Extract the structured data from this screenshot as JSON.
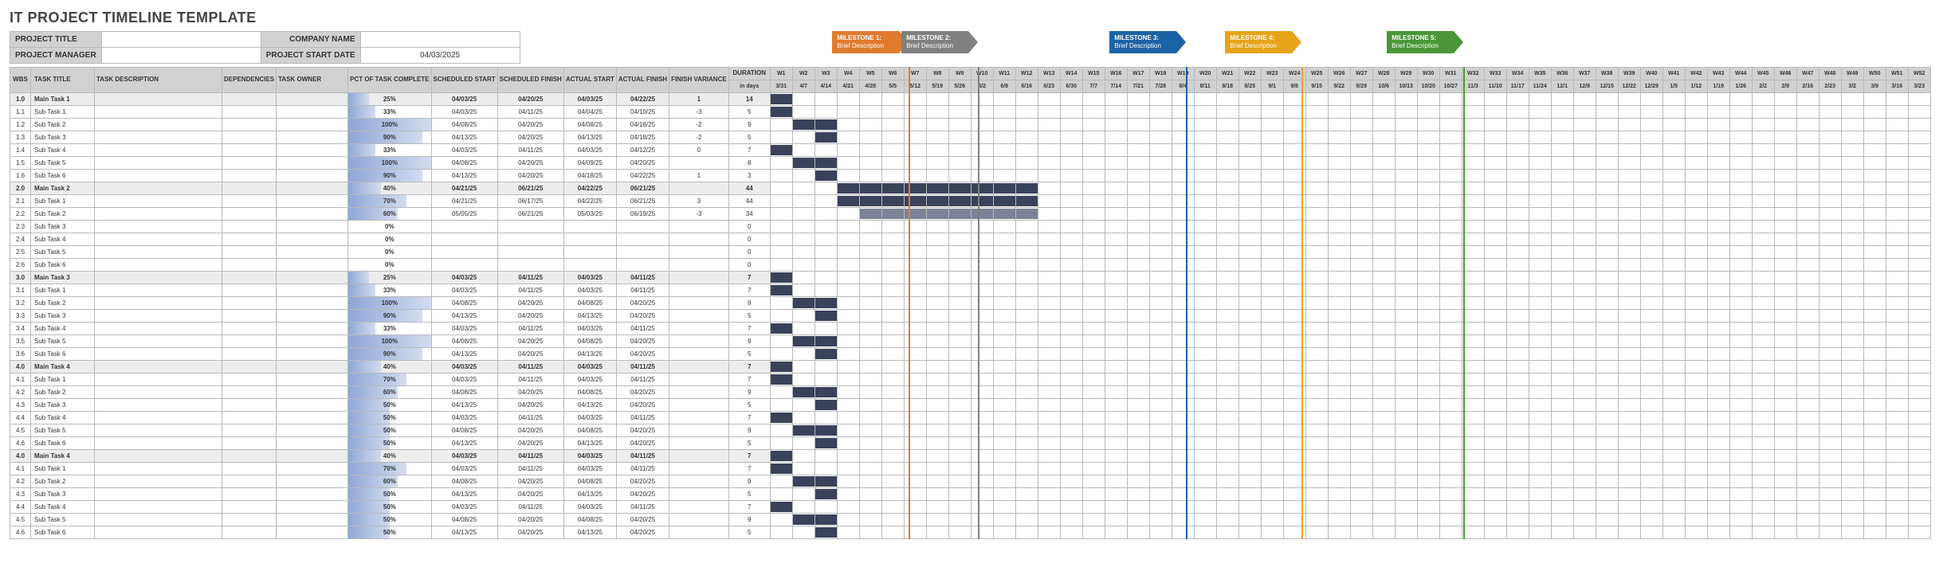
{
  "title": "IT PROJECT TIMELINE TEMPLATE",
  "info": {
    "project_title_lbl": "PROJECT TITLE",
    "project_title": "",
    "company_lbl": "COMPANY NAME",
    "company": "",
    "pm_lbl": "PROJECT MANAGER",
    "pm": "",
    "start_lbl": "PROJECT START DATE",
    "start": "04/03/2025"
  },
  "headers": {
    "wbs": "WBS",
    "task_title": "TASK TITLE",
    "task_desc": "TASK DESCRIPTION",
    "dep": "DEPENDENCIES",
    "owner": "TASK OWNER",
    "pct": "PCT OF TASK COMPLETE",
    "ss": "SCHEDULED START",
    "sf": "SCHEDULED FINISH",
    "as": "ACTUAL START",
    "af": "ACTUAL FINISH",
    "fv": "FINISH VARIANCE",
    "dur": "DURATION",
    "dur2": "in days"
  },
  "weeks": [
    {
      "w": "W1",
      "d": "3/31"
    },
    {
      "w": "W2",
      "d": "4/7"
    },
    {
      "w": "W3",
      "d": "4/14"
    },
    {
      "w": "W4",
      "d": "4/21"
    },
    {
      "w": "W5",
      "d": "4/28"
    },
    {
      "w": "W6",
      "d": "5/5"
    },
    {
      "w": "W7",
      "d": "5/12"
    },
    {
      "w": "W8",
      "d": "5/19"
    },
    {
      "w": "W9",
      "d": "5/26"
    },
    {
      "w": "W10",
      "d": "6/2"
    },
    {
      "w": "W11",
      "d": "6/9"
    },
    {
      "w": "W12",
      "d": "6/16"
    },
    {
      "w": "W13",
      "d": "6/23"
    },
    {
      "w": "W14",
      "d": "6/30"
    },
    {
      "w": "W15",
      "d": "7/7"
    },
    {
      "w": "W16",
      "d": "7/14"
    },
    {
      "w": "W17",
      "d": "7/21"
    },
    {
      "w": "W18",
      "d": "7/28"
    },
    {
      "w": "W19",
      "d": "8/4"
    },
    {
      "w": "W20",
      "d": "8/11"
    },
    {
      "w": "W21",
      "d": "8/18"
    },
    {
      "w": "W22",
      "d": "8/25"
    },
    {
      "w": "W23",
      "d": "9/1"
    },
    {
      "w": "W24",
      "d": "9/8"
    },
    {
      "w": "W25",
      "d": "9/15"
    },
    {
      "w": "W26",
      "d": "9/22"
    },
    {
      "w": "W27",
      "d": "9/29"
    },
    {
      "w": "W28",
      "d": "10/6"
    },
    {
      "w": "W29",
      "d": "10/13"
    },
    {
      "w": "W30",
      "d": "10/20"
    },
    {
      "w": "W31",
      "d": "10/27"
    },
    {
      "w": "W32",
      "d": "11/3"
    },
    {
      "w": "W33",
      "d": "11/10"
    },
    {
      "w": "W34",
      "d": "11/17"
    },
    {
      "w": "W35",
      "d": "11/24"
    },
    {
      "w": "W36",
      "d": "12/1"
    },
    {
      "w": "W37",
      "d": "12/8"
    },
    {
      "w": "W38",
      "d": "12/15"
    },
    {
      "w": "W39",
      "d": "12/22"
    },
    {
      "w": "W40",
      "d": "12/29"
    },
    {
      "w": "W41",
      "d": "1/5"
    },
    {
      "w": "W42",
      "d": "1/12"
    },
    {
      "w": "W43",
      "d": "1/19"
    },
    {
      "w": "W44",
      "d": "1/26"
    },
    {
      "w": "W45",
      "d": "2/2"
    },
    {
      "w": "W46",
      "d": "2/9"
    },
    {
      "w": "W47",
      "d": "2/16"
    },
    {
      "w": "W48",
      "d": "2/23"
    },
    {
      "w": "W49",
      "d": "3/2"
    },
    {
      "w": "W50",
      "d": "3/9"
    },
    {
      "w": "W51",
      "d": "3/16"
    },
    {
      "w": "W52",
      "d": "3/23"
    }
  ],
  "milestones": [
    {
      "name": "MILESTONE 1:",
      "sub": "Brief Description",
      "color": "#e07b2e",
      "week": 7
    },
    {
      "name": "MILESTONE 2:",
      "sub": "Brief Description",
      "color": "#808080",
      "week": 10
    },
    {
      "name": "MILESTONE 3:",
      "sub": "Brief Description",
      "color": "#1b62a5",
      "week": 19
    },
    {
      "name": "MILESTONE 4:",
      "sub": "Brief Description",
      "color": "#e8a41a",
      "week": 24
    },
    {
      "name": "MILESTONE 5:",
      "sub": "Brief Description",
      "color": "#4a9638",
      "week": 31
    }
  ],
  "rows": [
    {
      "main": true,
      "wbs": "1.0",
      "title": "Main Task 1",
      "pct": "25%",
      "ss": "04/03/25",
      "sf": "04/20/25",
      "as": "04/03/25",
      "af": "04/22/25",
      "fv": "1",
      "dur": "14",
      "bars": [
        [
          0,
          1
        ]
      ]
    },
    {
      "wbs": "1.1",
      "title": "Sub Task 1",
      "pct": "33%",
      "ss": "04/03/25",
      "sf": "04/11/25",
      "as": "04/04/25",
      "af": "04/10/25",
      "fv": "-3",
      "dur": "5",
      "bars": [
        [
          0,
          1
        ]
      ]
    },
    {
      "wbs": "1.2",
      "title": "Sub Task 2",
      "pct": "100%",
      "ss": "04/08/25",
      "sf": "04/20/25",
      "as": "04/08/25",
      "af": "04/18/25",
      "fv": "-2",
      "dur": "9",
      "bars": [
        [
          1,
          2
        ]
      ]
    },
    {
      "wbs": "1.3",
      "title": "Sub Task 3",
      "pct": "90%",
      "ss": "04/13/25",
      "sf": "04/20/25",
      "as": "04/13/25",
      "af": "04/18/25",
      "fv": "-2",
      "dur": "5",
      "bars": [
        [
          2,
          1
        ]
      ]
    },
    {
      "wbs": "1.4",
      "title": "Sub Task 4",
      "pct": "33%",
      "ss": "04/03/25",
      "sf": "04/11/25",
      "as": "04/03/25",
      "af": "04/12/25",
      "fv": "0",
      "dur": "7",
      "bars": [
        [
          0,
          1
        ]
      ]
    },
    {
      "wbs": "1.5",
      "title": "Sub Task 5",
      "pct": "100%",
      "ss": "04/08/25",
      "sf": "04/20/25",
      "as": "04/09/25",
      "af": "04/20/25",
      "fv": "",
      "dur": "8",
      "bars": [
        [
          1,
          2
        ]
      ]
    },
    {
      "wbs": "1.6",
      "title": "Sub Task 6",
      "pct": "90%",
      "ss": "04/13/25",
      "sf": "04/20/25",
      "as": "04/18/25",
      "af": "04/22/25",
      "fv": "1",
      "dur": "3",
      "bars": [
        [
          2,
          1
        ]
      ]
    },
    {
      "main": true,
      "wbs": "2.0",
      "title": "Main Task 2",
      "pct": "40%",
      "ss": "04/21/25",
      "sf": "06/21/25",
      "as": "04/22/25",
      "af": "06/21/25",
      "fv": "",
      "dur": "44",
      "bars": [
        [
          3,
          9
        ]
      ]
    },
    {
      "wbs": "2.1",
      "title": "Sub Task 1",
      "pct": "70%",
      "ss": "04/21/25",
      "sf": "06/17/25",
      "as": "04/22/25",
      "af": "06/21/25",
      "fv": "3",
      "dur": "44",
      "bars": [
        [
          3,
          9
        ]
      ]
    },
    {
      "wbs": "2.2",
      "title": "Sub Task 2",
      "pct": "60%",
      "ss": "05/05/25",
      "sf": "06/21/25",
      "as": "05/03/25",
      "af": "06/19/25",
      "fv": "-3",
      "dur": "34",
      "bars": [
        [
          4,
          8,
          "lt"
        ]
      ]
    },
    {
      "wbs": "2.3",
      "title": "Sub Task 3",
      "pct": "0%",
      "ss": "",
      "sf": "",
      "as": "",
      "af": "",
      "fv": "",
      "dur": "0",
      "bars": []
    },
    {
      "wbs": "2.4",
      "title": "Sub Task 4",
      "pct": "0%",
      "ss": "",
      "sf": "",
      "as": "",
      "af": "",
      "fv": "",
      "dur": "0",
      "bars": []
    },
    {
      "wbs": "2.5",
      "title": "Sub Task 5",
      "pct": "0%",
      "ss": "",
      "sf": "",
      "as": "",
      "af": "",
      "fv": "",
      "dur": "0",
      "bars": []
    },
    {
      "wbs": "2.6",
      "title": "Sub Task 6",
      "pct": "0%",
      "ss": "",
      "sf": "",
      "as": "",
      "af": "",
      "fv": "",
      "dur": "0",
      "bars": []
    },
    {
      "main": true,
      "wbs": "3.0",
      "title": "Main Task 3",
      "pct": "25%",
      "ss": "04/03/25",
      "sf": "04/11/25",
      "as": "04/03/25",
      "af": "04/11/25",
      "fv": "",
      "dur": "7",
      "bars": [
        [
          0,
          1
        ]
      ]
    },
    {
      "wbs": "3.1",
      "title": "Sub Task 1",
      "pct": "33%",
      "ss": "04/03/25",
      "sf": "04/11/25",
      "as": "04/03/25",
      "af": "04/11/25",
      "fv": "",
      "dur": "7",
      "bars": [
        [
          0,
          1
        ]
      ]
    },
    {
      "wbs": "3.2",
      "title": "Sub Task 2",
      "pct": "100%",
      "ss": "04/08/25",
      "sf": "04/20/25",
      "as": "04/08/25",
      "af": "04/20/25",
      "fv": "",
      "dur": "9",
      "bars": [
        [
          1,
          2
        ]
      ]
    },
    {
      "wbs": "3.3",
      "title": "Sub Task 3",
      "pct": "90%",
      "ss": "04/13/25",
      "sf": "04/20/25",
      "as": "04/13/25",
      "af": "04/20/25",
      "fv": "",
      "dur": "5",
      "bars": [
        [
          2,
          1
        ]
      ]
    },
    {
      "wbs": "3.4",
      "title": "Sub Task 4",
      "pct": "33%",
      "ss": "04/03/25",
      "sf": "04/11/25",
      "as": "04/03/25",
      "af": "04/11/25",
      "fv": "",
      "dur": "7",
      "bars": [
        [
          0,
          1
        ]
      ]
    },
    {
      "wbs": "3.5",
      "title": "Sub Task 5",
      "pct": "100%",
      "ss": "04/08/25",
      "sf": "04/20/25",
      "as": "04/08/25",
      "af": "04/20/25",
      "fv": "",
      "dur": "9",
      "bars": [
        [
          1,
          2
        ]
      ]
    },
    {
      "wbs": "3.6",
      "title": "Sub Task 6",
      "pct": "90%",
      "ss": "04/13/25",
      "sf": "04/20/25",
      "as": "04/13/25",
      "af": "04/20/25",
      "fv": "",
      "dur": "5",
      "bars": [
        [
          2,
          1
        ]
      ]
    },
    {
      "main": true,
      "wbs": "4.0",
      "title": "Main Task 4",
      "pct": "40%",
      "ss": "04/03/25",
      "sf": "04/11/25",
      "as": "04/03/25",
      "af": "04/11/25",
      "fv": "",
      "dur": "7",
      "bars": [
        [
          0,
          1
        ]
      ]
    },
    {
      "wbs": "4.1",
      "title": "Sub Task 1",
      "pct": "70%",
      "ss": "04/03/25",
      "sf": "04/11/25",
      "as": "04/03/25",
      "af": "04/11/25",
      "fv": "",
      "dur": "7",
      "bars": [
        [
          0,
          1
        ]
      ]
    },
    {
      "wbs": "4.2",
      "title": "Sub Task 2",
      "pct": "60%",
      "ss": "04/08/25",
      "sf": "04/20/25",
      "as": "04/08/25",
      "af": "04/20/25",
      "fv": "",
      "dur": "9",
      "bars": [
        [
          1,
          2
        ]
      ]
    },
    {
      "wbs": "4.3",
      "title": "Sub Task 3",
      "pct": "50%",
      "ss": "04/13/25",
      "sf": "04/20/25",
      "as": "04/13/25",
      "af": "04/20/25",
      "fv": "",
      "dur": "5",
      "bars": [
        [
          2,
          1
        ]
      ]
    },
    {
      "wbs": "4.4",
      "title": "Sub Task 4",
      "pct": "50%",
      "ss": "04/03/25",
      "sf": "04/11/25",
      "as": "04/03/25",
      "af": "04/11/25",
      "fv": "",
      "dur": "7",
      "bars": [
        [
          0,
          1
        ]
      ]
    },
    {
      "wbs": "4.5",
      "title": "Sub Task 5",
      "pct": "50%",
      "ss": "04/08/25",
      "sf": "04/20/25",
      "as": "04/08/25",
      "af": "04/20/25",
      "fv": "",
      "dur": "9",
      "bars": [
        [
          1,
          2
        ]
      ]
    },
    {
      "wbs": "4.6",
      "title": "Sub Task 6",
      "pct": "50%",
      "ss": "04/13/25",
      "sf": "04/20/25",
      "as": "04/13/25",
      "af": "04/20/25",
      "fv": "",
      "dur": "5",
      "bars": [
        [
          2,
          1
        ]
      ]
    },
    {
      "main": true,
      "wbs": "4.0",
      "title": "Main Task 4",
      "pct": "40%",
      "ss": "04/03/25",
      "sf": "04/11/25",
      "as": "04/03/25",
      "af": "04/11/25",
      "fv": "",
      "dur": "7",
      "bars": [
        [
          0,
          1
        ]
      ]
    },
    {
      "wbs": "4.1",
      "title": "Sub Task 1",
      "pct": "70%",
      "ss": "04/03/25",
      "sf": "04/11/25",
      "as": "04/03/25",
      "af": "04/11/25",
      "fv": "",
      "dur": "7",
      "bars": [
        [
          0,
          1
        ]
      ]
    },
    {
      "wbs": "4.2",
      "title": "Sub Task 2",
      "pct": "60%",
      "ss": "04/08/25",
      "sf": "04/20/25",
      "as": "04/08/25",
      "af": "04/20/25",
      "fv": "",
      "dur": "9",
      "bars": [
        [
          1,
          2
        ]
      ]
    },
    {
      "wbs": "4.3",
      "title": "Sub Task 3",
      "pct": "50%",
      "ss": "04/13/25",
      "sf": "04/20/25",
      "as": "04/13/25",
      "af": "04/20/25",
      "fv": "",
      "dur": "5",
      "bars": [
        [
          2,
          1
        ]
      ]
    },
    {
      "wbs": "4.4",
      "title": "Sub Task 4",
      "pct": "50%",
      "ss": "04/03/25",
      "sf": "04/11/25",
      "as": "04/03/25",
      "af": "04/11/25",
      "fv": "",
      "dur": "7",
      "bars": [
        [
          0,
          1
        ]
      ]
    },
    {
      "wbs": "4.5",
      "title": "Sub Task 5",
      "pct": "50%",
      "ss": "04/08/25",
      "sf": "04/20/25",
      "as": "04/08/25",
      "af": "04/20/25",
      "fv": "",
      "dur": "9",
      "bars": [
        [
          1,
          2
        ]
      ]
    },
    {
      "wbs": "4.6",
      "title": "Sub Task 6",
      "pct": "50%",
      "ss": "04/13/25",
      "sf": "04/20/25",
      "as": "04/13/25",
      "af": "04/20/25",
      "fv": "",
      "dur": "5",
      "bars": [
        [
          2,
          1
        ]
      ]
    }
  ]
}
